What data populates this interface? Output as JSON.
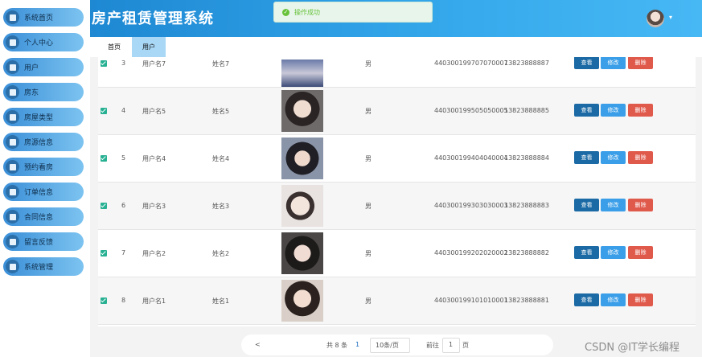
{
  "header": {
    "title": "房产租赁管理系统"
  },
  "toast": {
    "message": "操作成功"
  },
  "sidebar": {
    "items": [
      {
        "label": "系统首页",
        "icon": "home-icon"
      },
      {
        "label": "个人中心",
        "icon": "id-card-icon"
      },
      {
        "label": "用户",
        "icon": "user-icon"
      },
      {
        "label": "房东",
        "icon": "list-icon"
      },
      {
        "label": "房屋类型",
        "icon": "grid-icon"
      },
      {
        "label": "房源信息",
        "icon": "building-icon"
      },
      {
        "label": "预约看房",
        "icon": "calendar-icon"
      },
      {
        "label": "订单信息",
        "icon": "order-icon"
      },
      {
        "label": "合同信息",
        "icon": "location-icon"
      },
      {
        "label": "留言反馈",
        "icon": "message-icon"
      },
      {
        "label": "系统管理",
        "icon": "settings-icon"
      }
    ]
  },
  "tabs": [
    {
      "label": "首页"
    },
    {
      "label": "用户"
    }
  ],
  "table": {
    "rows": [
      {
        "index": "3",
        "username": "用户名7",
        "name": "姓名7",
        "gender": "男",
        "id_number": "440300199707070007",
        "phone": "13823888887",
        "checked": true
      },
      {
        "index": "4",
        "username": "用户名5",
        "name": "姓名5",
        "gender": "男",
        "id_number": "440300199505050005",
        "phone": "13823888885",
        "checked": true
      },
      {
        "index": "5",
        "username": "用户名4",
        "name": "姓名4",
        "gender": "男",
        "id_number": "440300199404040004",
        "phone": "13823888884",
        "checked": true
      },
      {
        "index": "6",
        "username": "用户名3",
        "name": "姓名3",
        "gender": "男",
        "id_number": "440300199303030003",
        "phone": "13823888883",
        "checked": true
      },
      {
        "index": "7",
        "username": "用户名2",
        "name": "姓名2",
        "gender": "男",
        "id_number": "440300199202020002",
        "phone": "13823888882",
        "checked": true
      },
      {
        "index": "8",
        "username": "用户名1",
        "name": "姓名1",
        "gender": "男",
        "id_number": "440300199101010001",
        "phone": "13823888881",
        "checked": true
      }
    ],
    "actions": {
      "view": "查看",
      "edit": "修改",
      "delete": "删除"
    }
  },
  "pagination": {
    "prev": "<",
    "total": "共 8 条",
    "current_page": "1",
    "page_size": "10条/页",
    "goto_label": "前往",
    "goto_value": "1",
    "page_unit": "页"
  },
  "watermark": "CSDN @IT学长编程",
  "colors": {
    "header": "#1e88d3",
    "sidebar_item": "#3a8fd8",
    "view": "#1b6aa5",
    "edit": "#3a9ee8",
    "delete": "#e05a4c",
    "checkbox": "#27b092",
    "success": "#67c23a"
  }
}
